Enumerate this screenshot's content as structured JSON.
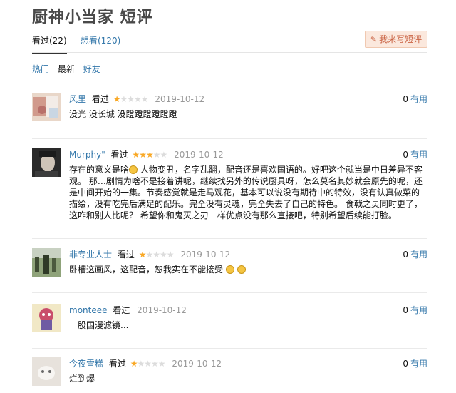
{
  "page": {
    "title": "厨神小当家 短评"
  },
  "tabs": [
    {
      "label": "看过(22)"
    },
    {
      "label": "想看(120)"
    }
  ],
  "write_button": {
    "label": "我来写短评",
    "icon": "pencil-icon"
  },
  "filters": [
    {
      "label": "热门"
    },
    {
      "label": "最新"
    },
    {
      "label": "好友"
    }
  ],
  "colors": {
    "link": "#3377aa",
    "star": "#f9a825",
    "accent": "#ca6445"
  },
  "comments": [
    {
      "user": "风里",
      "watched": "看过",
      "rating": 1,
      "date": "2019-10-12",
      "votes": "0",
      "useful": "有用",
      "text": "没光 没长城 没蹬蹬蹬蹬蹬蹬"
    },
    {
      "user": "Murphy\"",
      "watched": "看过",
      "rating": 3,
      "date": "2019-10-12",
      "votes": "0",
      "useful": "有用",
      "text_a": "存在的意义是啥",
      "text_b": " 人物变丑，名字乱翻，配音还是喜欢国语的。好吧这个就当是中日差异不客观。 那…剧情为啥不是接着讲呢，继续找另外的传说厨具呀，怎么莫名其妙就会原先的呢，还是中间开始的一集。节奏感觉就是走马观花，基本可以说没有期待中的特效，没有认真做菜的描绘，没有吃完后满足的配乐。完全没有灵魂，完全失去了自己的特色。 食戟之灵同时更了，这咋和别人比呢？ 希望你和鬼灭之刃一样优点没有那么直接吧，特别希望后续能打脸。"
    },
    {
      "user": "非专业人士",
      "watched": "看过",
      "rating": 1,
      "date": "2019-10-12",
      "votes": "0",
      "useful": "有用",
      "text": "卧槽这画风，这配音，恕我实在不能接受"
    },
    {
      "user": "monteee",
      "watched": "看过",
      "rating": 0,
      "date": "2019-10-12",
      "votes": "0",
      "useful": "有用",
      "text": "一股国漫滤镜..."
    },
    {
      "user": "今夜雪糕",
      "watched": "看过",
      "rating": 1,
      "date": "2019-10-12",
      "votes": "0",
      "useful": "有用",
      "text": "烂到爆"
    }
  ]
}
